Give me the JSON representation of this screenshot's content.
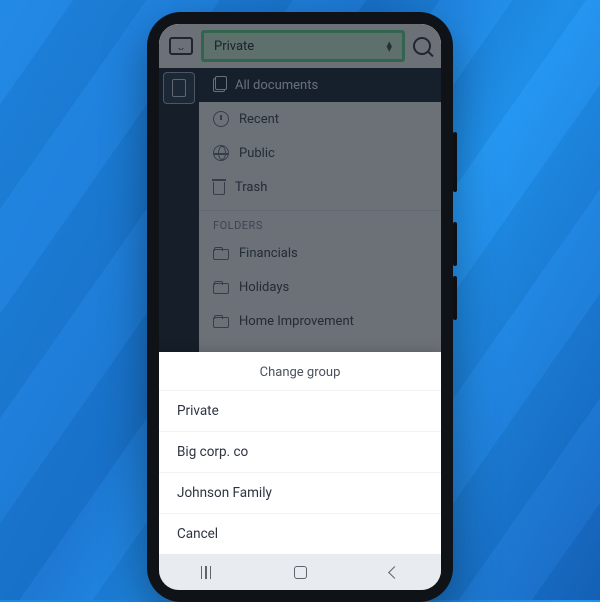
{
  "topbar": {
    "group_selected": "Private"
  },
  "sidebar": {
    "items": [
      {
        "label": "All documents"
      },
      {
        "label": "Recent"
      },
      {
        "label": "Public"
      },
      {
        "label": "Trash"
      }
    ],
    "folders_header": "FOLDERS",
    "folders": [
      {
        "label": "Financials"
      },
      {
        "label": "Holidays"
      },
      {
        "label": "Home Improvement"
      }
    ]
  },
  "sheet": {
    "title": "Change group",
    "options": [
      {
        "label": "Private"
      },
      {
        "label": "Big corp. co"
      },
      {
        "label": "Johnson Family"
      }
    ],
    "cancel": "Cancel"
  }
}
